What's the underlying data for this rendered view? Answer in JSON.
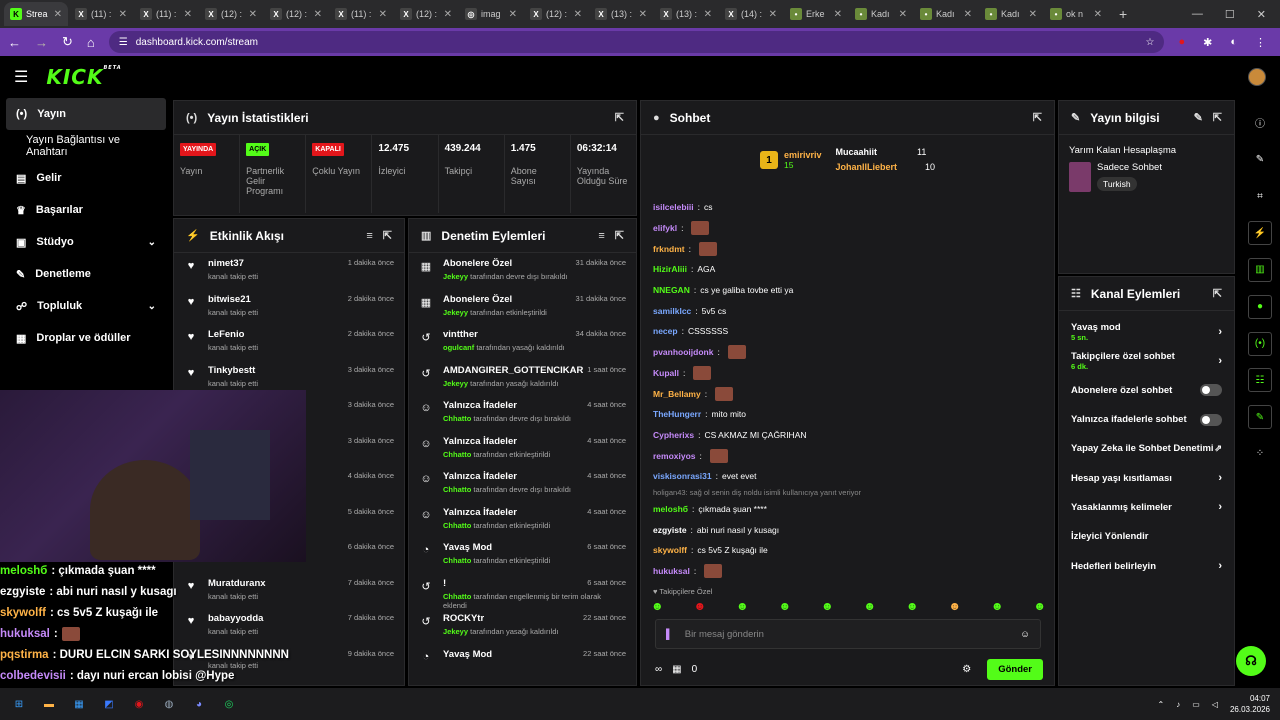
{
  "browser": {
    "tabs": [
      {
        "label": "Strea",
        "fav": "K",
        "favcolor": "#53fc18"
      },
      {
        "label": "(11) :",
        "fav": "X",
        "favcolor": "#444"
      },
      {
        "label": "(11) :",
        "fav": "X",
        "favcolor": "#444"
      },
      {
        "label": "(12) :",
        "fav": "X",
        "favcolor": "#444"
      },
      {
        "label": "(12) :",
        "fav": "X",
        "favcolor": "#444"
      },
      {
        "label": "(11) :",
        "fav": "X",
        "favcolor": "#444"
      },
      {
        "label": "(12) :",
        "fav": "X",
        "favcolor": "#444"
      },
      {
        "label": "imag",
        "fav": "◎",
        "favcolor": "#444"
      },
      {
        "label": "(12) :",
        "fav": "X",
        "favcolor": "#444"
      },
      {
        "label": "(13) :",
        "fav": "X",
        "favcolor": "#444"
      },
      {
        "label": "(13) :",
        "fav": "X",
        "favcolor": "#444"
      },
      {
        "label": "(14) :",
        "fav": "X",
        "favcolor": "#444"
      },
      {
        "label": "Erke",
        "fav": "•",
        "favcolor": "#6a8a3a"
      },
      {
        "label": "Kadı",
        "fav": "•",
        "favcolor": "#6a8a3a"
      },
      {
        "label": "Kadı",
        "fav": "•",
        "favcolor": "#6a8a3a"
      },
      {
        "label": "Kadı",
        "fav": "•",
        "favcolor": "#6a8a3a"
      },
      {
        "label": "ok n",
        "fav": "•",
        "favcolor": "#6a8a3a"
      }
    ],
    "url": "dashboard.kick.com/stream"
  },
  "sidebar": {
    "items": [
      {
        "label": "Yayın",
        "icon": "broadcast-icon"
      },
      {
        "label": "Yayın Bağlantısı ve Anahtarı"
      },
      {
        "label": "Gelir",
        "icon": "wallet-icon"
      },
      {
        "label": "Başarılar",
        "icon": "trophy-icon"
      },
      {
        "label": "Stüdyo",
        "icon": "studio-icon"
      },
      {
        "label": "Denetleme",
        "icon": "wrench-icon"
      },
      {
        "label": "Topluluk",
        "icon": "community-icon"
      },
      {
        "label": "Droplar ve ödüller",
        "icon": "gift-icon"
      }
    ]
  },
  "stats": {
    "title": "Yayın İstatistikleri",
    "items": [
      {
        "badge": "YAYINDA",
        "label": "Yayın",
        "color": "#e3161b"
      },
      {
        "badge": "AÇIK",
        "label": "Partnerlik Gelir Programı",
        "color": "#53fc18"
      },
      {
        "badge": "KAPALI",
        "label": "Çoklu Yayın",
        "color": "#e3161b"
      },
      {
        "value": "12.475",
        "label": "İzleyici"
      },
      {
        "value": "439.244",
        "label": "Takipçi"
      },
      {
        "value": "1.475",
        "label": "Abone Sayısı"
      },
      {
        "value": "06:32:14",
        "label": "Yayında Olduğu Süre"
      }
    ]
  },
  "activity": {
    "title": "Etkinlik Akışı",
    "items": [
      {
        "name": "nimet37",
        "time": "1 dakika önce",
        "sub": "kanalı takip etti"
      },
      {
        "name": "bitwise21",
        "time": "2 dakika önce",
        "sub": "kanalı takip etti"
      },
      {
        "name": "LeFenio",
        "time": "2 dakika önce",
        "sub": "kanalı takip etti"
      },
      {
        "name": "Tinkybestt",
        "time": "3 dakika önce",
        "sub": "kanalı takip etti"
      },
      {
        "name": "",
        "time": "3 dakika önce",
        "sub": ""
      },
      {
        "name": "",
        "time": "3 dakika önce",
        "sub": ""
      },
      {
        "name": "",
        "time": "4 dakika önce",
        "sub": ""
      },
      {
        "name": "",
        "time": "5 dakika önce",
        "sub": ""
      },
      {
        "name": "",
        "time": "6 dakika önce",
        "sub": ""
      },
      {
        "name": "Muratduranx",
        "time": "7 dakika önce",
        "sub": "kanalı takip etti"
      },
      {
        "name": "babayyodda",
        "time": "7 dakika önce",
        "sub": "kanalı takip etti"
      },
      {
        "name": "",
        "time": "9 dakika önce",
        "sub": "kanalı takip etti"
      }
    ]
  },
  "moderation": {
    "title": "Denetim Eylemleri",
    "items": [
      {
        "name": "Abonelere Özel",
        "time": "31 dakika önce",
        "who": "Jekeyy",
        "sub": "tarafından devre dışı bırakıldı",
        "icon": "gift-icon"
      },
      {
        "name": "Abonelere Özel",
        "time": "31 dakika önce",
        "who": "Jekeyy",
        "sub": "tarafından etkinleştirildi",
        "icon": "gift-icon"
      },
      {
        "name": "vintther",
        "time": "34 dakika önce",
        "who": "ogulcanf",
        "sub": "tarafından yasağı kaldırıldı",
        "icon": "undo-icon"
      },
      {
        "name": "AMDANGIRER_GOTTENCIKARIM",
        "time": "1 saat önce",
        "who": "Jekeyy",
        "sub": "tarafından yasağı kaldırıldı",
        "icon": "undo-icon"
      },
      {
        "name": "Yalnızca İfadeler",
        "time": "4 saat önce",
        "who": "Chhatto",
        "sub": "tarafından devre dışı bırakıldı",
        "icon": "smile-icon"
      },
      {
        "name": "Yalnızca İfadeler",
        "time": "4 saat önce",
        "who": "Chhatto",
        "sub": "tarafından etkinleştirildi",
        "icon": "smile-icon"
      },
      {
        "name": "Yalnızca İfadeler",
        "time": "4 saat önce",
        "who": "Chhatto",
        "sub": "tarafından devre dışı bırakıldı",
        "icon": "smile-icon"
      },
      {
        "name": "Yalnızca İfadeler",
        "time": "4 saat önce",
        "who": "Chhatto",
        "sub": "tarafından etkinleştirildi",
        "icon": "smile-icon"
      },
      {
        "name": "Yavaş Mod",
        "time": "6 saat önce",
        "who": "Chhatto",
        "sub": "tarafından etkinleştirildi",
        "icon": "snail-icon"
      },
      {
        "name": "!",
        "time": "6 saat önce",
        "who": "Chhatto",
        "sub": "tarafından engellenmiş bir terim olarak eklendi",
        "icon": "undo-icon"
      },
      {
        "name": "ROCKYtr",
        "time": "22 saat önce",
        "who": "Jekeyy",
        "sub": "tarafından yasağı kaldırıldı",
        "icon": "undo-icon"
      },
      {
        "name": "Yavaş Mod",
        "time": "22 saat önce",
        "who": "",
        "sub": "",
        "icon": "snail-icon"
      }
    ]
  },
  "chat": {
    "title": "Sohbet",
    "pinned": [
      {
        "name": "emirivriv",
        "count": "15",
        "rank": "1"
      },
      {
        "name": "Mucaahiit",
        "count": "11"
      },
      {
        "name": "JohanIlLiebert",
        "count": "10"
      }
    ],
    "lines": [
      {
        "user": "isilcelebiii",
        "color": "#c58af9",
        "text": "cs"
      },
      {
        "user": "elifykl",
        "color": "#c58af9",
        "text": "",
        "emote": true
      },
      {
        "user": "frkndmt",
        "color": "#ffb347",
        "text": "",
        "emote": true
      },
      {
        "user": "HizirAliii",
        "color": "#53fc18",
        "text": "AGA",
        "emote": false
      },
      {
        "user": "NNEGAN",
        "color": "#53fc18",
        "text": "cs ye galiba tovbe etti ya"
      },
      {
        "user": "samilklcc",
        "color": "#7aa8ff",
        "text": "5v5 cs"
      },
      {
        "user": "necep",
        "color": "#7aa8ff",
        "text": "CSSSSSS"
      },
      {
        "user": "pvanhooijdonk",
        "color": "#c58af9",
        "text": "",
        "emote": true
      },
      {
        "user": "Kupall",
        "color": "#c58af9",
        "text": "",
        "emote": true
      },
      {
        "user": "Mr_Bellamy",
        "color": "#ffb347",
        "text": "",
        "emote": true
      },
      {
        "user": "TheHungerr",
        "color": "#7aa8ff",
        "text": "mito mito"
      },
      {
        "user": "Cypherixs",
        "color": "#c58af9",
        "text": "CS AKMAZ MI ÇAĞRIHAN"
      },
      {
        "user": "remoxiyos",
        "color": "#c58af9",
        "text": "",
        "emote": true
      },
      {
        "user": "viskisonrasi31",
        "color": "#7aa8ff",
        "text": "evet evet"
      },
      {
        "user": "meloshб",
        "color": "#53fc18",
        "text": "çıkmada şuan ****"
      },
      {
        "user": "ezgyiste",
        "color": "#fff",
        "text": "abi nuri nasıl y kusagı"
      },
      {
        "user": "skywolff",
        "color": "#ffb347",
        "text": "cs 5v5 Z kuşağı ile"
      },
      {
        "user": "hukuksal",
        "color": "#c58af9",
        "text": "",
        "emote": true
      }
    ],
    "reply_note": "holigan43: sağ ol senin diş noldu isimli kullanıcıya yanıt veriyor",
    "followers_label": "Takipçilere Özel",
    "placeholder": "Bir mesaj gönderin",
    "count": "0",
    "send_label": "Gönder"
  },
  "info": {
    "title": "Yayın bilgisi",
    "stream_title": "Yarım Kalan Hesaplaşma",
    "category": "Sadece Sohbet",
    "tag": "Turkish"
  },
  "channel_actions": {
    "title": "Kanal Eylemleri",
    "items": [
      {
        "label": "Yavaş mod",
        "sub": "5 sn.",
        "kind": "chev"
      },
      {
        "label": "Takipçilere özel sohbet",
        "sub": "6 dk.",
        "kind": "chev"
      },
      {
        "label": "Abonelere özel sohbet",
        "sub": "",
        "kind": "toggle"
      },
      {
        "label": "Yalnızca ifadelerle sohbet",
        "sub": "",
        "kind": "toggle"
      },
      {
        "label": "Yapay Zeka ile Sohbet Denetimi",
        "sub": "",
        "kind": "ext"
      },
      {
        "label": "Hesap yaşı kısıtlaması",
        "sub": "",
        "kind": "chev"
      },
      {
        "label": "Yasaklanmış kelimeler",
        "sub": "",
        "kind": "chev"
      },
      {
        "label": "İzleyici Yönlendir",
        "sub": "",
        "kind": "none"
      },
      {
        "label": "Hedefleri belirleyin",
        "sub": "",
        "kind": "chev"
      }
    ]
  },
  "overlay_chat": [
    {
      "user": "meloshб",
      "color": "#53fc18",
      "text": ": çıkmada şuan ****"
    },
    {
      "user": "ezgyiste",
      "color": "#fff",
      "text": ": abi nuri nasıl y kusagı"
    },
    {
      "user": "skywolff",
      "color": "#ffb347",
      "text": ": cs 5v5 Z kuşağı ile"
    },
    {
      "user": "hukuksal",
      "color": "#c58af9",
      "text": ":"
    },
    {
      "user": "pqstirma",
      "color": "#ffb347",
      "text": ": DURU ELCIN SARKI SOYLESINNNNNNNN"
    },
    {
      "user": "colbedevisii",
      "color": "#c58af9",
      "text": ": dayı nuri ercan lobisi @Hype"
    }
  ],
  "taskbar": {
    "time": "04:07",
    "date": "26.03.2026"
  }
}
